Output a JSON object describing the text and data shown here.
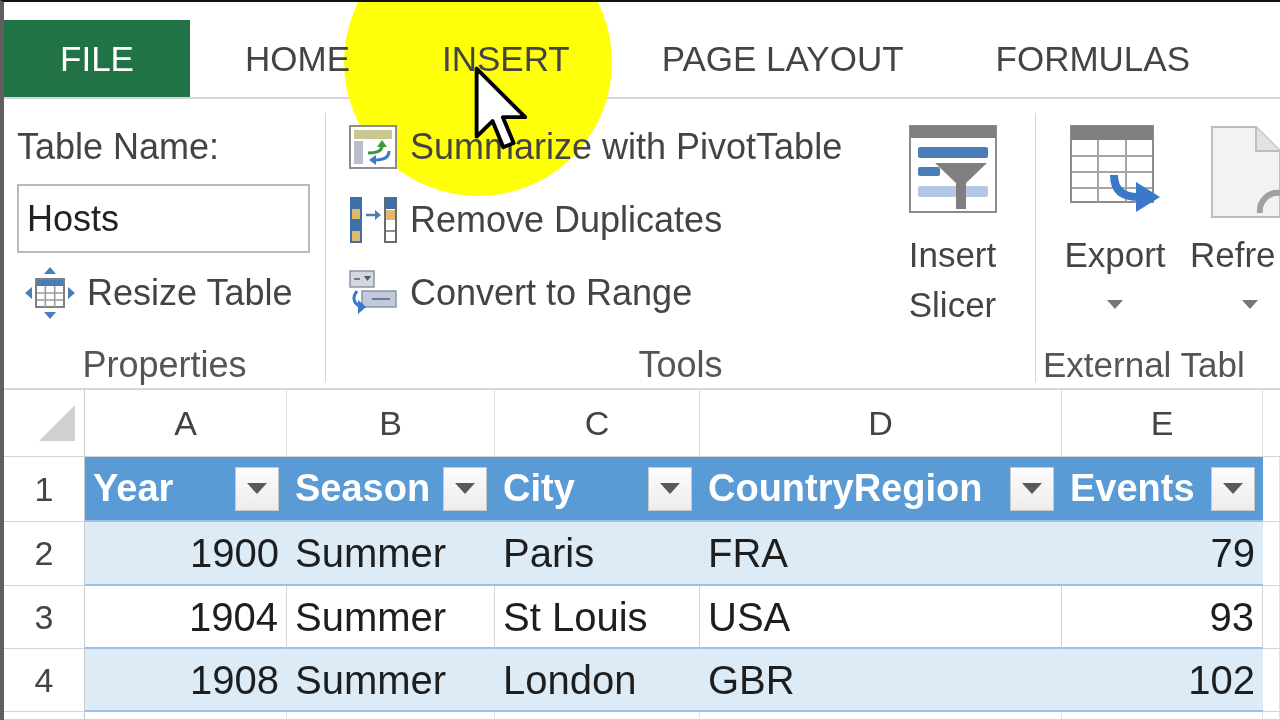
{
  "ribbon_tabs": [
    {
      "label": "FILE",
      "kind": "file",
      "selected": false
    },
    {
      "label": "HOME",
      "kind": "tab",
      "selected": false
    },
    {
      "label": "INSERT",
      "kind": "tab",
      "selected": false
    },
    {
      "label": "PAGE LAYOUT",
      "kind": "tab",
      "selected": false
    },
    {
      "label": "FORMULAS",
      "kind": "tab",
      "selected": false
    }
  ],
  "ribbon_groups": [
    {
      "label": "Properties",
      "kind": "properties",
      "field_label": "Table Name:",
      "field_value": "Hosts",
      "commands": [
        {
          "label": "Resize Table"
        }
      ]
    },
    {
      "label": "Tools",
      "kind": "tools",
      "commands": [
        {
          "label": "Summarize with PivotTable"
        },
        {
          "label": "Remove Duplicates"
        },
        {
          "label": "Convert to Range"
        }
      ],
      "large_buttons": [
        {
          "label": "Insert Slicer",
          "dropdown": false
        }
      ]
    },
    {
      "label": "External Tabl",
      "kind": "external",
      "large_buttons": [
        {
          "label": "Export",
          "dropdown": true
        },
        {
          "label": "Refre",
          "dropdown": true
        }
      ]
    }
  ],
  "sheet": {
    "column_headers": [
      "A",
      "B",
      "C",
      "D",
      "E"
    ],
    "row_headers": [
      "1",
      "2",
      "3",
      "4"
    ],
    "table": {
      "columns": [
        {
          "label": "Year",
          "kind": "number",
          "filter": true
        },
        {
          "label": "Season",
          "kind": "text",
          "filter": true
        },
        {
          "label": "City",
          "kind": "text",
          "filter": true
        },
        {
          "label": "CountryRegion",
          "kind": "text",
          "filter": true
        },
        {
          "label": "Events",
          "kind": "number",
          "filter": true
        }
      ],
      "rows": [
        [
          "1900",
          "Summer",
          "Paris",
          "FRA",
          "79"
        ],
        [
          "1904",
          "Summer",
          "St Louis",
          "USA",
          "93"
        ],
        [
          "1908",
          "Summer",
          "London",
          "GBR",
          "102"
        ]
      ]
    }
  }
}
